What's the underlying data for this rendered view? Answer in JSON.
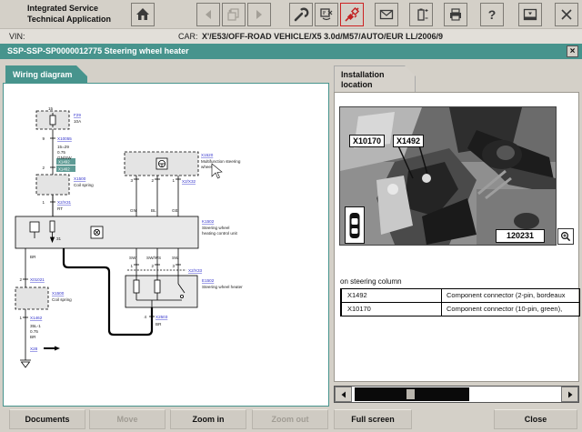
{
  "header": {
    "app_line1": "Integrated Service",
    "app_line2": "Technical Application",
    "toolbar_icons": [
      "home-icon",
      "back-icon",
      "copy-icon",
      "forward-icon",
      "wrench-icon",
      "monitor-icon",
      "connector-icon",
      "mail-icon",
      "battery-icon",
      "printer-icon",
      "help-icon",
      "window-icon",
      "close-icon"
    ]
  },
  "vin_row": {
    "vin_label": "VIN:",
    "car_label": "CAR:",
    "car_value": "X'/E53/OFF-ROAD VEHICLE/X5 3.0d/M57/AUTO/EUR LL/2006/9"
  },
  "doc_bar": {
    "title": "SSP-SSP-SP0000012775 Steering wheel heater",
    "close_glyph": "×"
  },
  "tabs": {
    "wiring": "Wiring diagram",
    "install_line1": "Installation",
    "install_line2": "location"
  },
  "diagram": {
    "fuse": {
      "terminal": "15",
      "link": "F29",
      "amps": "10A"
    },
    "feed": {
      "pin": "9",
      "link": "X10055",
      "spec1": "15=29",
      "spec2": "0.75",
      "spec3": "GN/SW"
    },
    "sel": {
      "pin": "2",
      "label1": "X1492",
      "label2": "X1462"
    },
    "coil1": {
      "link": "X1500",
      "name": "Coil spring",
      "pin": "1",
      "pin_link": "X2/X31",
      "wire": "RT"
    },
    "mfw": {
      "link": "X1520",
      "name1": "Multifunction steering",
      "name2": "wheel",
      "pin3": "3",
      "pin2": "2",
      "pin1": "1",
      "pin_link": "X2/X32",
      "w1": "GN",
      "w2": "BL",
      "w3": "GE"
    },
    "ctrl": {
      "link": "K1502",
      "name1": "Steering wheel",
      "name2": "heating control unit",
      "gnd": "31"
    },
    "out": {
      "p1": "1",
      "p2": "2",
      "p3": "3",
      "w1": "SW",
      "w2": "SW/WS",
      "w3": "SW",
      "link": "X2/X33"
    },
    "heater": {
      "link": "E1502",
      "name": "Steering wheel heater",
      "pin": "4",
      "pin_link": "X2503",
      "wire": "BR"
    },
    "ret": {
      "wire": "BR",
      "pin": "2",
      "link": "X01021",
      "coil_link": "X1500",
      "coil_name": "Coil spring",
      "pin1": "1",
      "pin1_link": "X1462",
      "spec1": "35L-1",
      "spec2": "0.75",
      "spec3": "BR",
      "gnd_link": "X28"
    }
  },
  "installation": {
    "photo_label_left": "X10170",
    "photo_label_right": "X1492",
    "photo_ref": "120231",
    "caption": "on steering column",
    "table": {
      "row1_id": "X1492",
      "row1_desc": "Component connector (2-pin, bordeaux",
      "row2_id": "X10170",
      "row2_desc": "Component connector (10-pin, green),"
    }
  },
  "buttons": {
    "documents": "Documents",
    "move": "Move",
    "zoom_in": "Zoom in",
    "zoom_out": "Zoom out",
    "full_screen": "Full screen",
    "close": "Close"
  },
  "colors": {
    "teal": "#47948D",
    "chrome": "#D4D0C8",
    "link_blue": "#3333CC",
    "alert_red": "#C22222"
  }
}
